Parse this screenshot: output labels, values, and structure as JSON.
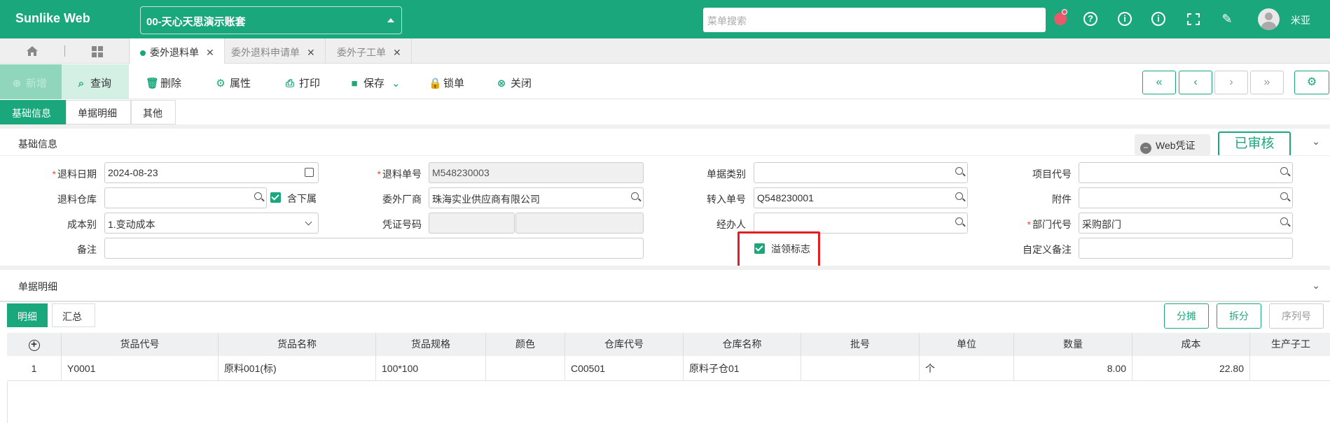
{
  "brand": "Sunlike Web",
  "account": "00-天心天思演示账套",
  "menu_search_placeholder": "菜单搜索",
  "user": "米亚",
  "tabs": [
    "委外退料单",
    "委外退料申请单",
    "委外子工单"
  ],
  "toolbar": {
    "new": "新增",
    "query": "查询",
    "delete": "删除",
    "properties": "属性",
    "print": "打印",
    "save": "保存",
    "lock": "锁单",
    "close": "关闭"
  },
  "subtabs": [
    "基础信息",
    "单据明细",
    "其他"
  ],
  "basic_section": {
    "title": "基础信息",
    "web_voucher": "Web凭证",
    "status": "已审核"
  },
  "form": {
    "return_date_label": "退料日期",
    "return_date": "2024-08-23",
    "return_no_label": "退料单号",
    "return_no": "M548230003",
    "doc_type_label": "单据类别",
    "doc_type": "",
    "project_label": "项目代号",
    "project": "",
    "warehouse_label": "退料仓库",
    "warehouse": "",
    "include_sub_label": "含下属",
    "vendor_label": "委外厂商",
    "vendor": "珠海实业供应商有限公司",
    "transfer_no_label": "转入单号",
    "transfer_no": "Q548230001",
    "attachment_label": "附件",
    "attachment": "",
    "cost_type_label": "成本别",
    "cost_type": "1.变动成本",
    "voucher_no_label": "凭证号码",
    "handler_label": "经办人",
    "handler": "",
    "dept_label": "部门代号",
    "dept": "采购部门",
    "remark_label": "备注",
    "remark": "",
    "overflow_label": "溢领标志",
    "custom_remark_label": "自定义备注",
    "custom_remark": ""
  },
  "detail_section": {
    "title": "单据明细",
    "views": [
      "明细",
      "汇总"
    ],
    "buttons": [
      "分摊",
      "拆分",
      "序列号"
    ]
  },
  "grid": {
    "columns": [
      "货品代号",
      "货品名称",
      "货品规格",
      "颜色",
      "仓库代号",
      "仓库名称",
      "批号",
      "单位",
      "数量",
      "成本",
      "生产子工"
    ],
    "rows": [
      {
        "no": "1",
        "code": "Y0001",
        "name": "原料001(标)",
        "spec": "100*100",
        "color": "",
        "wh_code": "C00501",
        "wh_name": "原料子仓01",
        "batch": "",
        "unit": "个",
        "qty": "8.00",
        "cost": "22.80",
        "sub": ""
      }
    ]
  }
}
